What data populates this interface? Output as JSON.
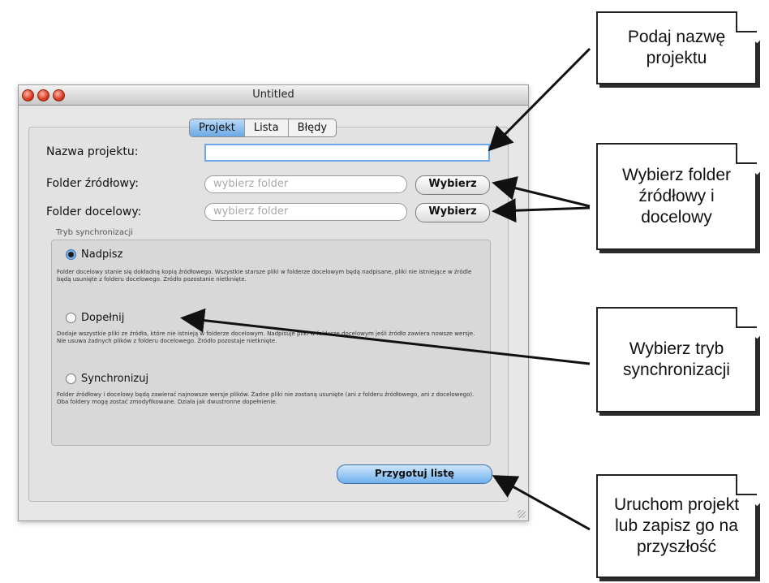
{
  "window": {
    "title": "Untitled",
    "tabs": [
      "Projekt",
      "Lista",
      "Błędy"
    ],
    "project_name_label": "Nazwa projektu:",
    "project_name_value": "",
    "source_folder_label": "Folder źródłowy:",
    "source_folder_placeholder": "wybierz folder",
    "target_folder_label": "Folder docelowy:",
    "target_folder_placeholder": "wybierz folder",
    "choose_button": "Wybierz",
    "sync_mode_label": "Tryb synchronizacji",
    "options": [
      {
        "label": "Nadpisz",
        "selected": true,
        "description": "Folder docelowy stanie się dokładną kopią źródłowego. Wszystkie starsze pliki w folderze docelowym będą nadpisane, pliki nie istniejące w źródle będą usunięte z folderu docelowego. Źródło pozostanie nietknięte."
      },
      {
        "label": "Dopełnij",
        "selected": false,
        "description": "Dodaje wszystkie pliki ze źródła, które nie istnieją w folderze docelowym. Nadpisuje pliki w folderze docelowym jeśli źródło zawiera nowsze wersje. Nie usuwa żadnych plików z folderu docelowego. Źródło pozostaje nietknięte."
      },
      {
        "label": "Synchronizuj",
        "selected": false,
        "description": "Folder źródłowy i docelowy będą zawierać najnowsze wersje plików. Żadne pliki nie zostaną usunięte (ani z folderu źródłowego, ani z docelowego). Oba foldery mogą zostać zmodyfikowane. Działa jak dwustronne dopełnienie."
      }
    ],
    "prepare_button": "Przygotuj listę"
  },
  "callouts": {
    "project_name": "Podaj nazwę projektu",
    "folders": "Wybierz folder źródłowy i docelowy",
    "sync_mode": "Wybierz tryb synchronizacji",
    "run": "Uruchom projekt lub zapisz go na przyszłość"
  },
  "colors": {
    "accent": "#6aa8ea",
    "window_bg": "#e7e7e7"
  }
}
